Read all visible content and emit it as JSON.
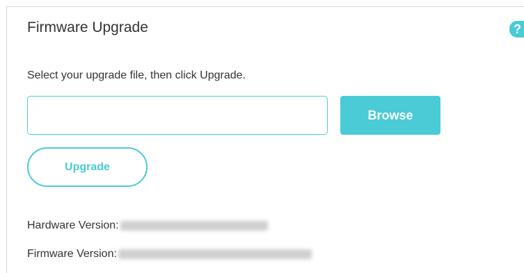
{
  "section": {
    "title": "Firmware Upgrade",
    "help_icon_glyph": "?",
    "instruction": "Select your upgrade file, then click Upgrade."
  },
  "file_field": {
    "value": "",
    "placeholder": ""
  },
  "buttons": {
    "browse_label": "Browse",
    "upgrade_label": "Upgrade"
  },
  "versions": {
    "hardware_label": "Hardware Version:",
    "firmware_label": "Firmware Version:"
  },
  "colors": {
    "accent": "#4acbd6",
    "text": "#333333",
    "border": "#d6d6d6",
    "redacted": "#cfcfcf"
  },
  "icons": {
    "help": "question-mark-icon",
    "redaction": "blurred-value"
  }
}
